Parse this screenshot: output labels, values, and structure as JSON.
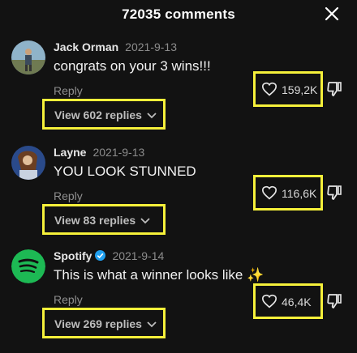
{
  "header": {
    "title": "72035 comments"
  },
  "comments": [
    {
      "name": "Jack Orman",
      "date": "2021-9-13",
      "text": "congrats on your 3 wins!!!",
      "reply_label": "Reply",
      "view_replies": "View 602 replies",
      "likes": "159,2K"
    },
    {
      "name": "Layne",
      "date": "2021-9-13",
      "text": "YOU LOOK STUNNED",
      "reply_label": "Reply",
      "view_replies": "View 83 replies",
      "likes": "116,6K"
    },
    {
      "name": "Spotify",
      "date": "2021-9-14",
      "text": "This is what a winner looks like ✨",
      "reply_label": "Reply",
      "view_replies": "View 269 replies",
      "likes": "46,4K",
      "verified": true
    }
  ],
  "colors": {
    "highlight": "#f5f03a",
    "background": "#121212",
    "spotify_green": "#1db954",
    "verified_blue": "#20a0f0"
  },
  "icons": [
    "close-icon",
    "heart-icon",
    "dislike-icon",
    "chevron-down-icon",
    "verified-icon"
  ]
}
